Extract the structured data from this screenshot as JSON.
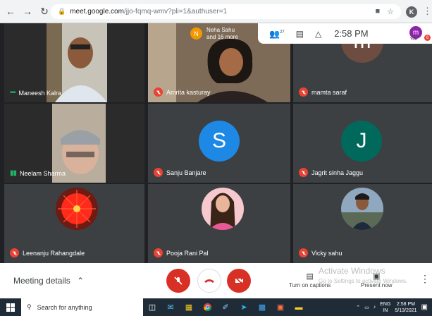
{
  "browser": {
    "url_host": "meet.google.com",
    "url_path": "/jjo-fqmq-wmv?pli=1&authuser=1",
    "profile_initial": "K"
  },
  "topbar": {
    "presenter_initial": "N",
    "presenter_line1": "Neha Sahu",
    "presenter_line2": "and 16 more",
    "people_count": "27",
    "time": "2:58 PM",
    "you_initial": "m",
    "you_label": "You",
    "you_badge": "6"
  },
  "tiles": [
    {
      "name": "Maneesh Kalra",
      "type": "video",
      "status": "speaking"
    },
    {
      "name": "Amrita kasturay",
      "type": "video",
      "status": "muted"
    },
    {
      "name": "mamta saraf",
      "type": "avatar",
      "initial": "m",
      "color": "#6d4c41",
      "status": "muted"
    },
    {
      "name": "Neelam Sharma",
      "type": "video",
      "status": "speaking"
    },
    {
      "name": "Sanju Banjare",
      "type": "avatar",
      "initial": "S",
      "color": "#1e88e5",
      "status": "muted"
    },
    {
      "name": "Jagrit sinha Jaggu",
      "type": "avatar",
      "initial": "J",
      "color": "#00695c",
      "status": "muted"
    },
    {
      "name": "Leenanju Rahangdale",
      "type": "photo",
      "status": "muted"
    },
    {
      "name": "Pooja Rani Pal",
      "type": "photo",
      "status": "muted"
    },
    {
      "name": "Vicky sahu",
      "type": "photo",
      "status": "muted"
    }
  ],
  "controls": {
    "meeting_details": "Meeting details",
    "captions_label": "Turn on captions",
    "present_label": "Present now",
    "watermark_line1": "Activate Windows",
    "watermark_line2": "Go to Settings to activate Windows."
  },
  "taskbar": {
    "search_placeholder": "Search for anything",
    "lang_top": "ENG",
    "lang_bottom": "IN",
    "clock_time": "2:58 PM",
    "clock_date": "5/13/2021"
  }
}
